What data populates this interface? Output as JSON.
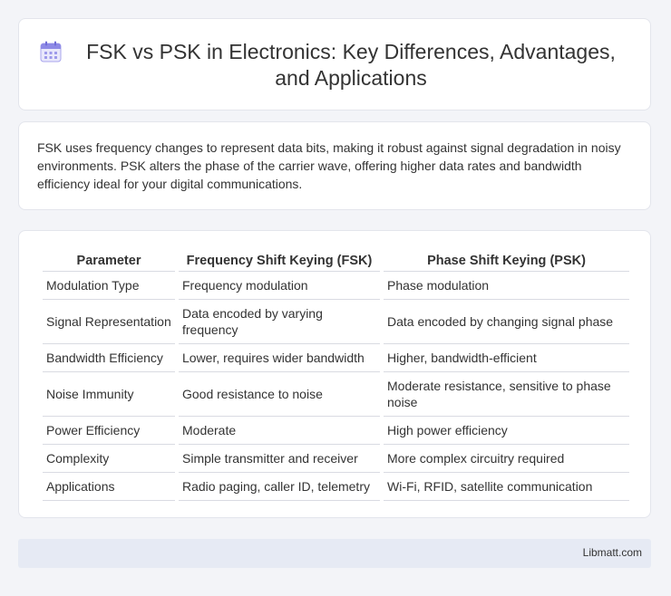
{
  "header": {
    "title": "FSK vs PSK in Electronics: Key Differences, Advantages, and Applications",
    "icon": "calendar-icon",
    "icon_color": "#7b7fe0"
  },
  "summary": {
    "text": "FSK uses frequency changes to represent data bits, making it robust against signal degradation in noisy environments. PSK alters the phase of the carrier wave, offering higher data rates and bandwidth efficiency ideal for your digital communications."
  },
  "table": {
    "headers": [
      "Parameter",
      "Frequency Shift Keying (FSK)",
      "Phase Shift Keying (PSK)"
    ],
    "rows": [
      [
        "Modulation Type",
        "Frequency modulation",
        "Phase modulation"
      ],
      [
        "Signal Representation",
        "Data encoded by varying frequency",
        "Data encoded by changing signal phase"
      ],
      [
        "Bandwidth Efficiency",
        "Lower, requires wider bandwidth",
        "Higher, bandwidth-efficient"
      ],
      [
        "Noise Immunity",
        "Good resistance to noise",
        "Moderate resistance, sensitive to phase noise"
      ],
      [
        "Power Efficiency",
        "Moderate",
        "High power efficiency"
      ],
      [
        "Complexity",
        "Simple transmitter and receiver",
        "More complex circuitry required"
      ],
      [
        "Applications",
        "Radio paging, caller ID, telemetry",
        "Wi-Fi, RFID, satellite communication"
      ]
    ]
  },
  "footer": {
    "site": "Libmatt.com"
  }
}
